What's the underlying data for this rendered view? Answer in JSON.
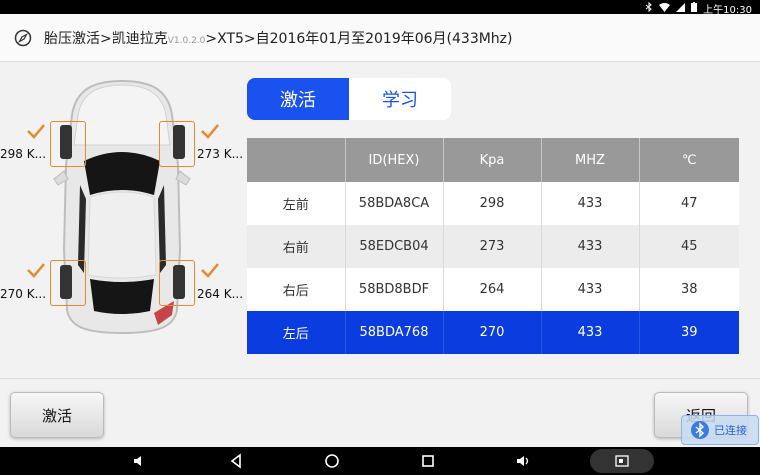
{
  "status": {
    "time": "上午10:30"
  },
  "header": {
    "title_main": "胎压激活>凯迪拉克",
    "version": "V1.0.2.0",
    "title_rest": ">XT5>自2016年01月至2019年06月(433Mhz)"
  },
  "car": {
    "pressures": {
      "fl": "298 K...",
      "fr": "273 K...",
      "rl": "270 K...",
      "rr": "264 K..."
    }
  },
  "tabs": {
    "activate": "激活",
    "learn": "学习",
    "selected": "activate"
  },
  "table": {
    "headers": [
      "",
      "ID(HEX)",
      "Kpa",
      "MHZ",
      "℃"
    ],
    "rows": [
      [
        "左前",
        "58BDA8CA",
        "298",
        "433",
        "47"
      ],
      [
        "右前",
        "58EDCB04",
        "273",
        "433",
        "45"
      ],
      [
        "右后",
        "58BD8BDF",
        "264",
        "433",
        "38"
      ],
      [
        "左后",
        "58BDA768",
        "270",
        "433",
        "39"
      ]
    ],
    "selected_row": 3
  },
  "footer": {
    "activate_label": "激活",
    "back_label": "返回"
  },
  "bluetooth": {
    "label": "已连接"
  },
  "colors": {
    "accent": "#1a52f0",
    "selected_row": "#0a3ce0",
    "check": "#e8892b"
  }
}
